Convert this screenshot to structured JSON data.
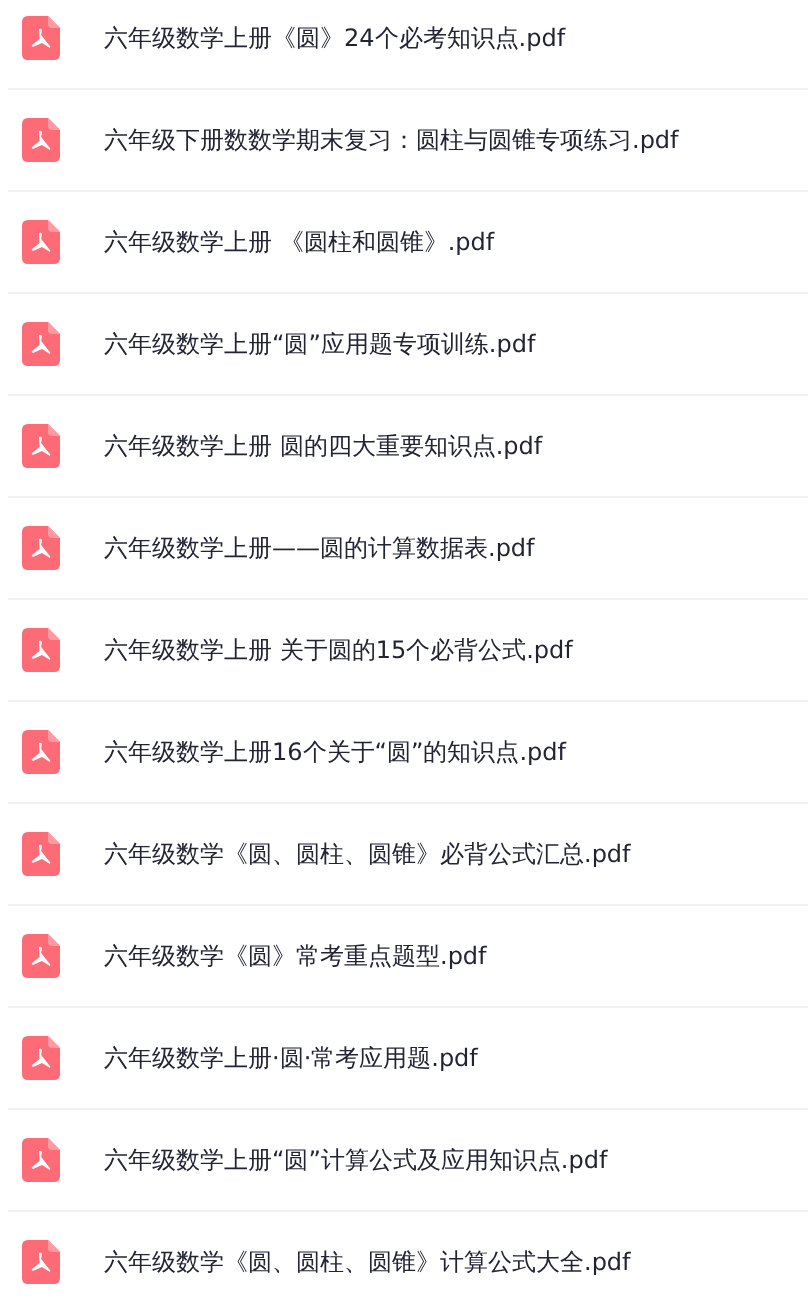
{
  "files": [
    {
      "name": "六年级数学上册《圆》24个必考知识点.pdf"
    },
    {
      "name": "六年级下册数数学期末复习：圆柱与圆锥专项练习.pdf"
    },
    {
      "name": "六年级数学上册 《圆柱和圆锥》.pdf"
    },
    {
      "name": "六年级数学上册“圆”应用题专项训练.pdf"
    },
    {
      "name": "六年级数学上册 圆的四大重要知识点.pdf"
    },
    {
      "name": "六年级数学上册——圆的计算数据表.pdf"
    },
    {
      "name": "六年级数学上册 关于圆的15个必背公式.pdf"
    },
    {
      "name": "六年级数学上册16个关于“圆”的知识点.pdf"
    },
    {
      "name": "六年级数学《圆、圆柱、圆锥》必背公式汇总.pdf"
    },
    {
      "name": "六年级数学《圆》常考重点题型.pdf"
    },
    {
      "name": "六年级数学上册·圆·常考应用题.pdf"
    },
    {
      "name": "六年级数学上册“圆”计算公式及应用知识点.pdf"
    },
    {
      "name": "六年级数学《圆、圆柱、圆锥》计算公式大全.pdf"
    }
  ]
}
